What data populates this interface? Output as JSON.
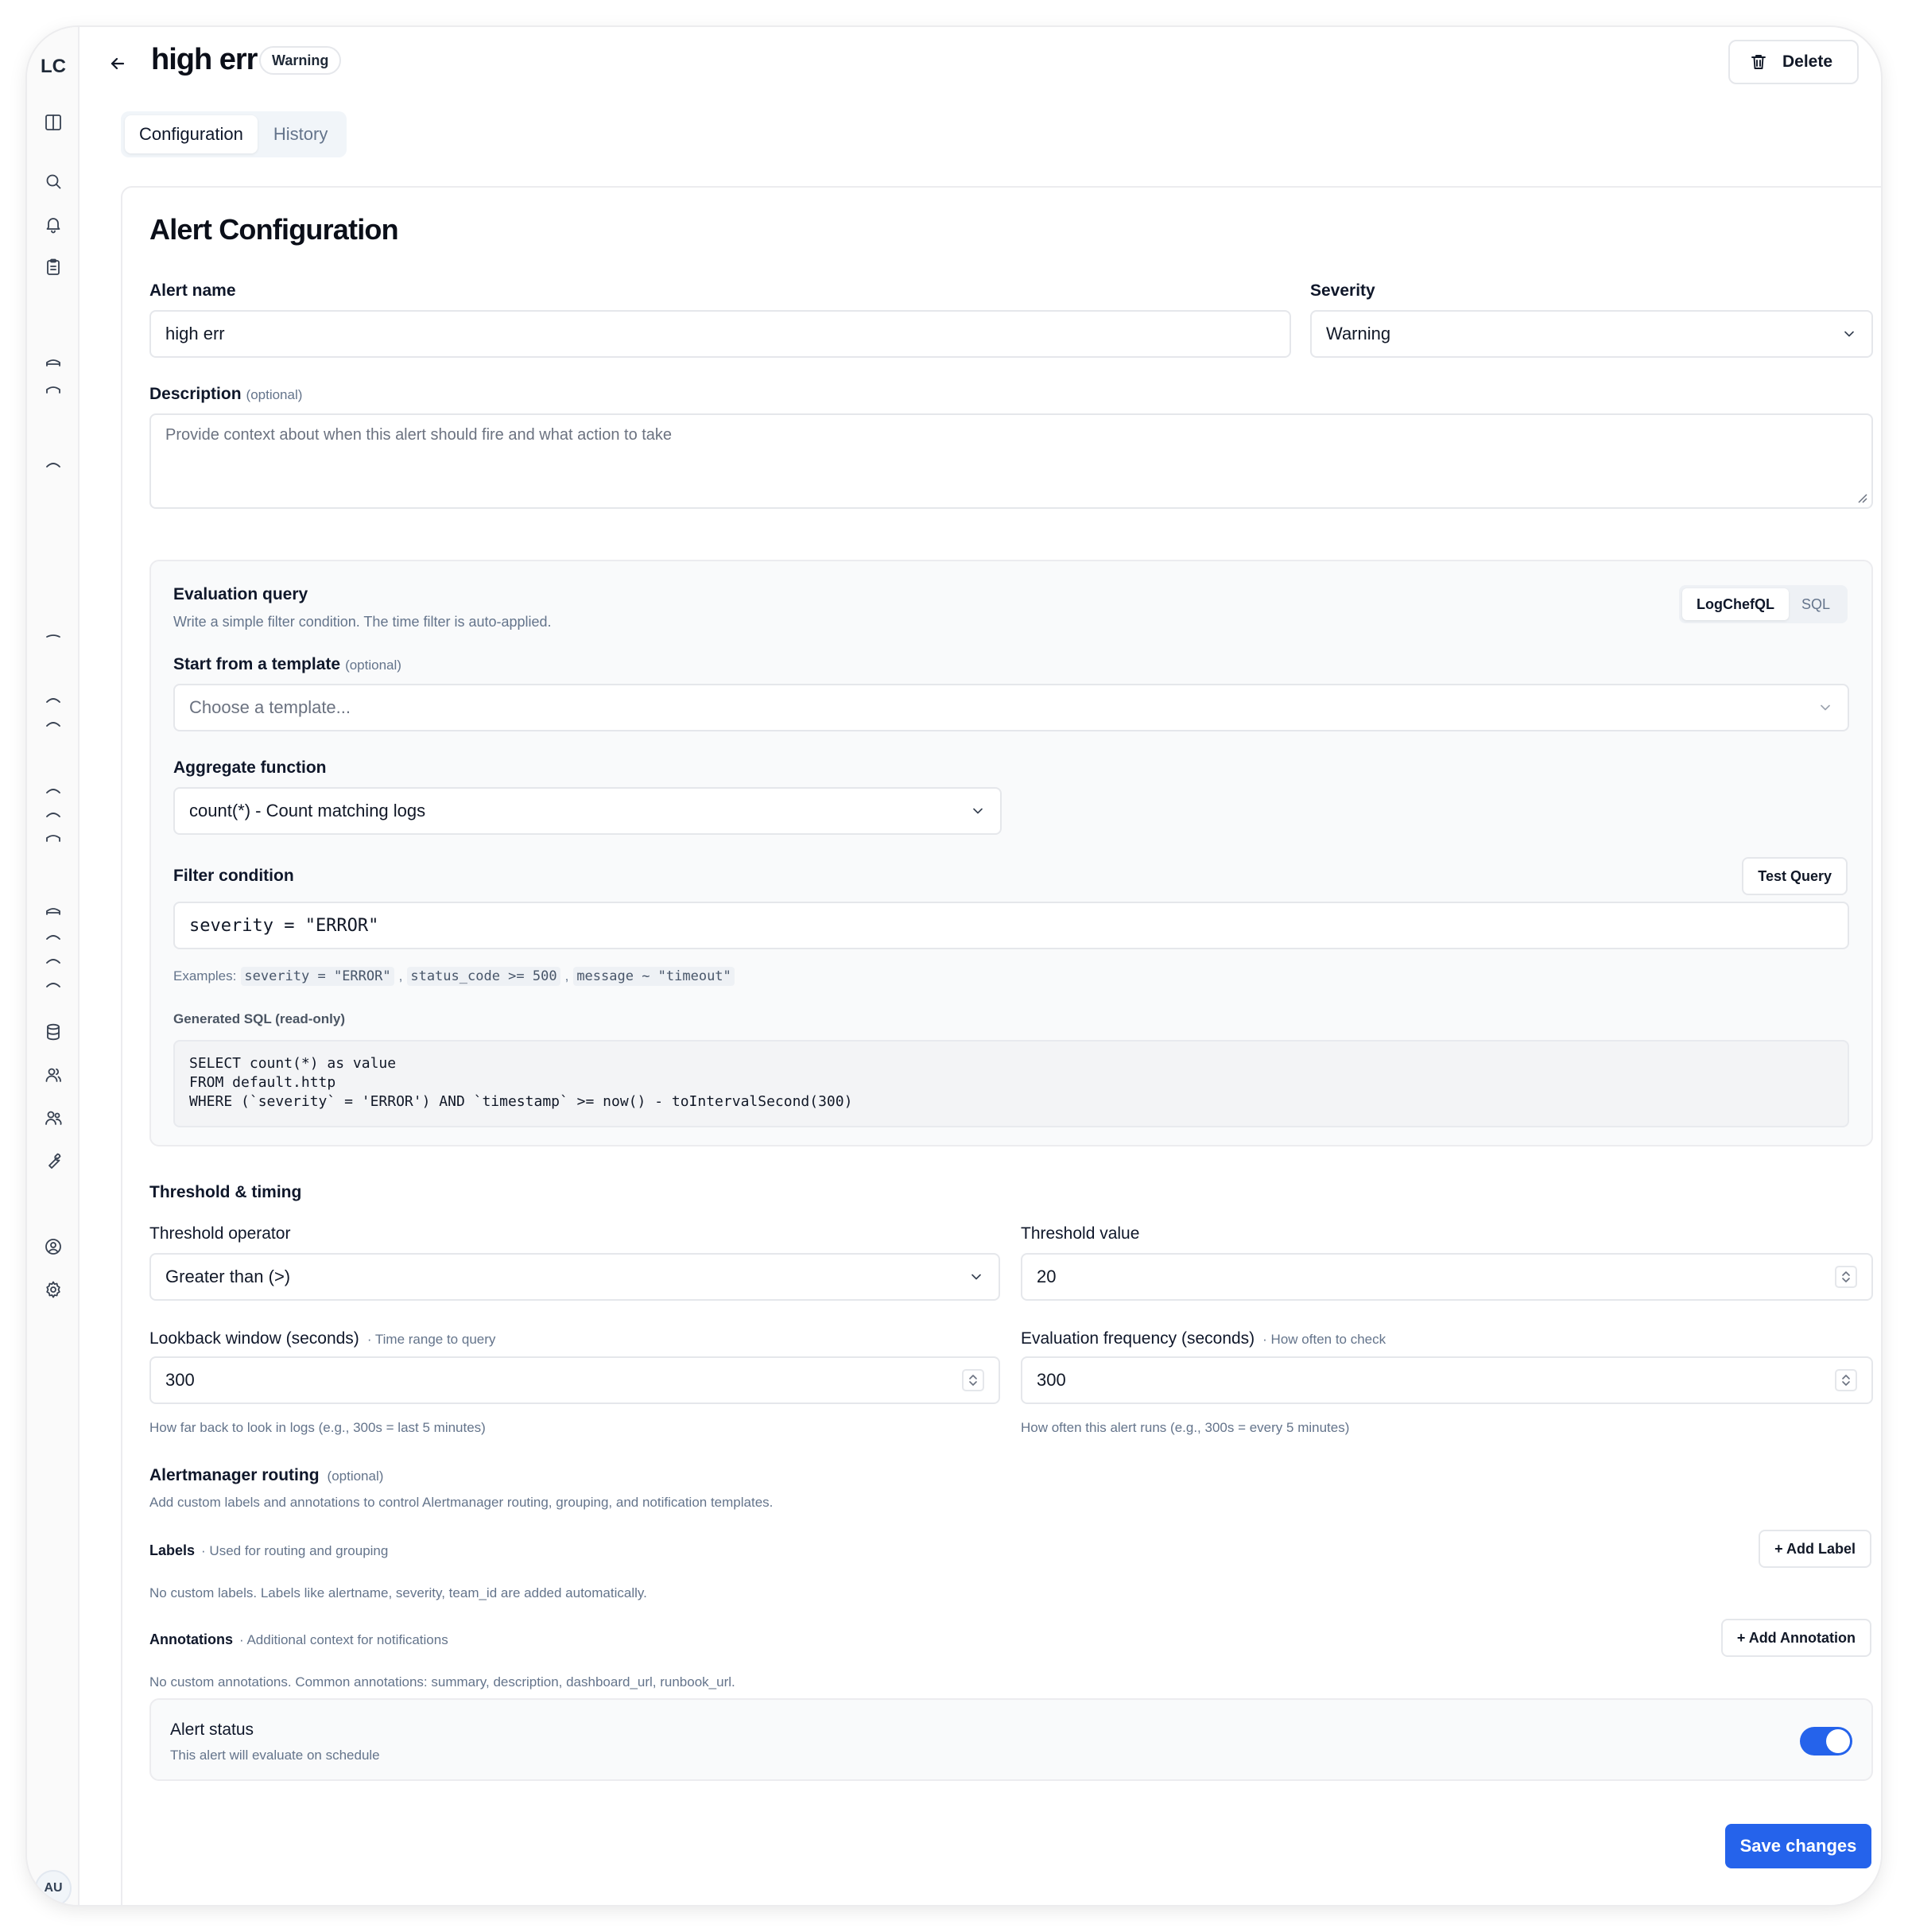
{
  "sidebar": {
    "logo": "LC",
    "avatar": "AU",
    "icons": [
      "panel-toggle-icon",
      "search-icon",
      "bell-icon",
      "clipboard-icon",
      "database-icon",
      "users-icon",
      "team-icon",
      "wrench-icon",
      "user-circle-icon",
      "gear-icon"
    ]
  },
  "header": {
    "title": "high err",
    "badge": "Warning",
    "delete_label": "Delete"
  },
  "tabs": [
    {
      "label": "Configuration",
      "active": true
    },
    {
      "label": "History",
      "active": false
    }
  ],
  "form": {
    "heading": "Alert Configuration",
    "alert_name": {
      "label": "Alert name",
      "value": "high err"
    },
    "severity": {
      "label": "Severity",
      "value": "Warning"
    },
    "description": {
      "label": "Description",
      "optional": "(optional)",
      "placeholder": "Provide context about when this alert should fire and what action to take"
    },
    "evaluation": {
      "title": "Evaluation query",
      "subtitle": "Write a simple filter condition. The time filter is auto-applied.",
      "modes": [
        "LogChefQL",
        "SQL"
      ],
      "template": {
        "label": "Start from a template",
        "optional": "(optional)",
        "placeholder": "Choose a template..."
      },
      "aggregate": {
        "label": "Aggregate function",
        "value": "count(*) - Count matching logs"
      },
      "filter": {
        "label": "Filter condition",
        "test_label": "Test Query",
        "value": "severity = \"ERROR\""
      },
      "examples": {
        "prefix": "Examples:",
        "items": [
          "severity = \"ERROR\"",
          "status_code >= 500",
          "message ~ \"timeout\""
        ],
        "sep": ","
      },
      "generated_sql": {
        "label": "Generated SQL (read-only)",
        "lines": [
          "SELECT count(*) as value",
          "FROM default.http",
          "WHERE (`severity` = 'ERROR') AND `timestamp` >= now() - toIntervalSecond(300)"
        ]
      }
    },
    "threshold": {
      "heading": "Threshold & timing",
      "operator": {
        "label": "Threshold operator",
        "value": "Greater than (>)"
      },
      "value": {
        "label": "Threshold value",
        "value": "20"
      },
      "lookback": {
        "label": "Lookback window (seconds)",
        "note": "· Time range to query",
        "value": "300",
        "hint": "How far back to look in logs (e.g., 300s = last 5 minutes)"
      },
      "frequency": {
        "label": "Evaluation frequency (seconds)",
        "note": "· How often to check",
        "value": "300",
        "hint": "How often this alert runs (e.g., 300s = every 5 minutes)"
      }
    },
    "routing": {
      "heading": "Alertmanager routing",
      "optional": "(optional)",
      "subtitle": "Add custom labels and annotations to control Alertmanager routing, grouping, and notification templates.",
      "labels": {
        "label": "Labels",
        "note": "· Used for routing and grouping",
        "add": "+ Add Label",
        "empty": "No custom labels. Labels like alertname, severity, team_id are added automatically."
      },
      "annotations": {
        "label": "Annotations",
        "note": "· Additional context for notifications",
        "add": "+ Add Annotation",
        "empty": "No custom annotations. Common annotations: summary, description, dashboard_url, runbook_url."
      }
    },
    "status": {
      "title": "Alert status",
      "subtitle": "This alert will evaluate on schedule",
      "enabled": true
    },
    "save_label": "Save changes"
  },
  "colors": {
    "accent": "#2563eb",
    "border": "#e5e7eb",
    "muted": "#64748b"
  }
}
